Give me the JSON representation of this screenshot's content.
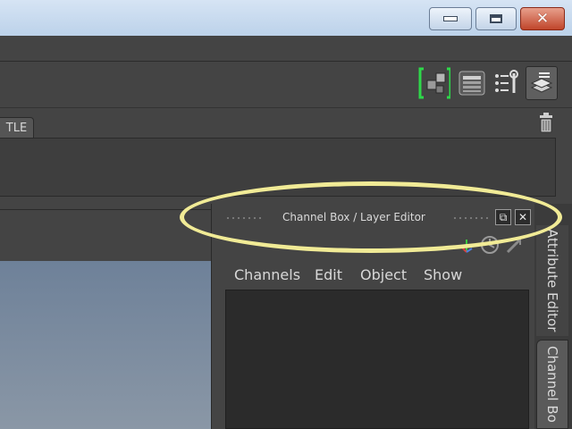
{
  "window": {
    "minimize_label": "minimize",
    "maximize_label": "maximize",
    "close_label": "close"
  },
  "toolbar": {
    "icons": [
      "modeling-toolkit-icon",
      "attribute-spreadsheet-icon",
      "tool-settings-icon",
      "channel-box-layer-icon"
    ],
    "highlight_color": "#2ed84a"
  },
  "tabs": [
    {
      "label": "TLE"
    }
  ],
  "channel_box": {
    "title": "Channel Box / Layer Editor",
    "menu": [
      "Channels",
      "Edit",
      "Object",
      "Show"
    ],
    "float_label": "float",
    "close_label": "close"
  },
  "side_tabs": {
    "attribute_editor": "Attribute Editor",
    "channel_box": "Channel Bo"
  },
  "annotation": {
    "highlight_color": "#f1eb96"
  }
}
